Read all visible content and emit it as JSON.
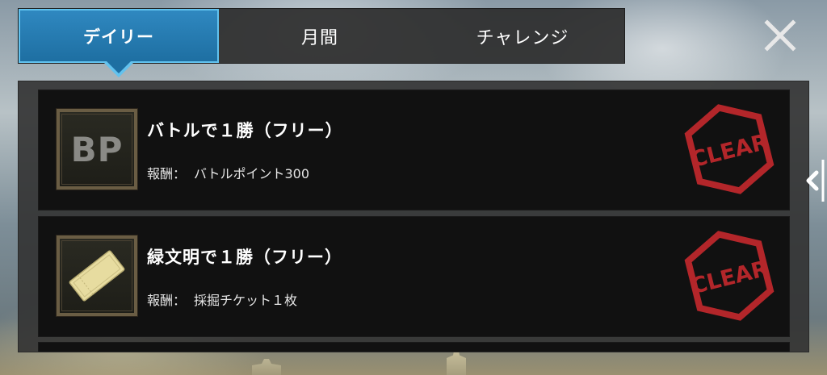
{
  "tabs": [
    {
      "label": "デイリー",
      "selected": true
    },
    {
      "label": "月間",
      "selected": false
    },
    {
      "label": "チャレンジ",
      "selected": false
    }
  ],
  "close": {
    "icon": "close-icon"
  },
  "missions": [
    {
      "title": "バトルで１勝（フリー）",
      "reward_label": "報酬：",
      "reward_value": "バトルポイント300",
      "icon_text": "BP",
      "icon": "battle-point-icon",
      "status": "CLEAR"
    },
    {
      "title": "緑文明で１勝（フリー）",
      "reward_label": "報酬：",
      "reward_value": "採掘チケット１枚",
      "icon": "ticket-icon",
      "status": "CLEAR"
    }
  ],
  "side_handle": {
    "icon": "chevron-left-icon"
  },
  "colors": {
    "tab_active": "#2f88c0",
    "tab_active_border": "#62c2ee",
    "clear_stamp": "#b3262a",
    "card_bg": "#111111"
  }
}
